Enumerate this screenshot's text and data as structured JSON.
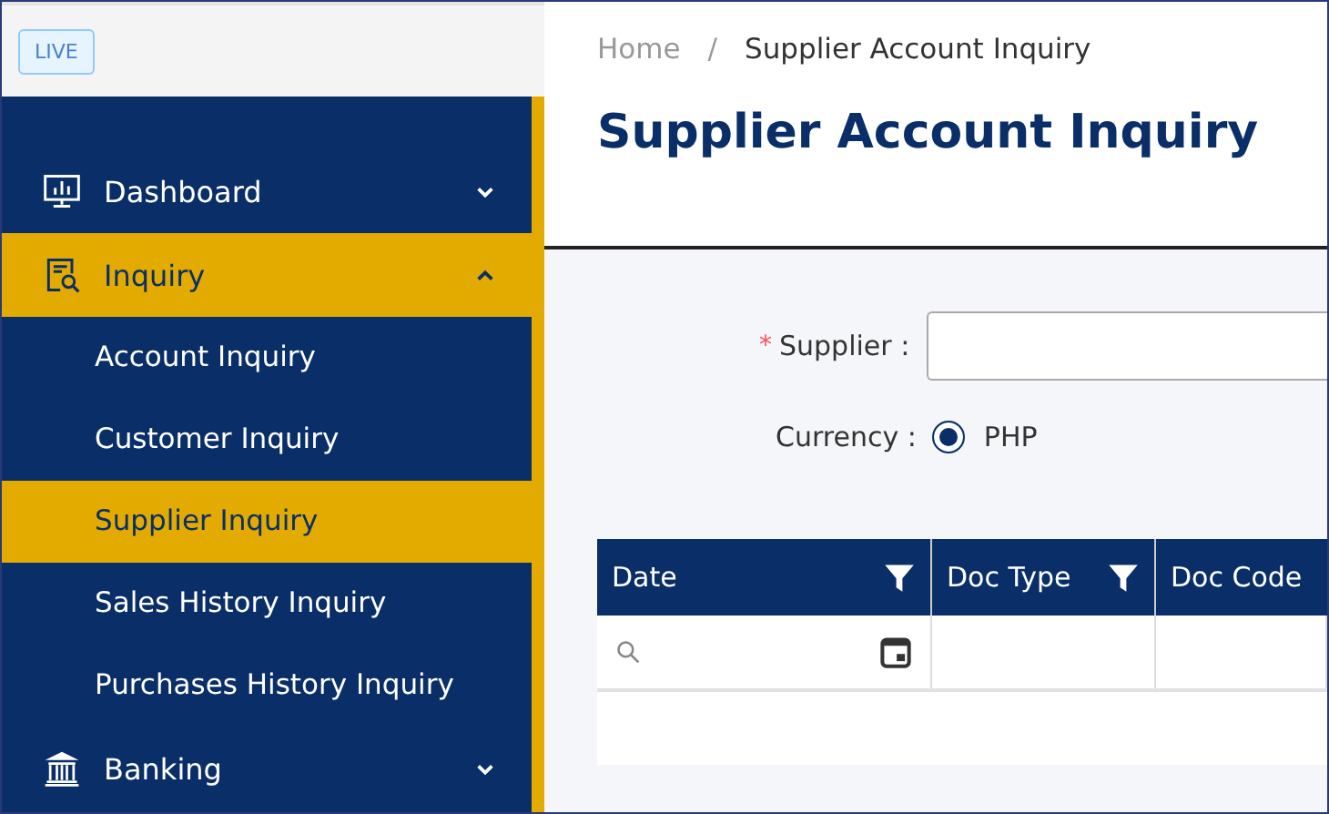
{
  "badge": "LIVE",
  "nav": [
    {
      "label": "Dashboard",
      "expanded": false,
      "selected": false
    },
    {
      "label": "Inquiry",
      "expanded": true,
      "selected": true,
      "children": [
        {
          "label": "Account Inquiry",
          "selected": false
        },
        {
          "label": "Customer Inquiry",
          "selected": false
        },
        {
          "label": "Supplier Inquiry",
          "selected": true
        },
        {
          "label": "Sales History Inquiry",
          "selected": false
        },
        {
          "label": "Purchases History Inquiry",
          "selected": false
        }
      ]
    },
    {
      "label": "Banking",
      "expanded": false,
      "selected": false
    }
  ],
  "breadcrumb": [
    "Home",
    "/",
    "Supplier Account Inquiry"
  ],
  "title": "Supplier Account Inquiry",
  "form": {
    "supplier": {
      "required_mark": "*",
      "label": "Supplier :"
    },
    "currency": {
      "label": "Currency :",
      "options": [
        {
          "label": "PHP",
          "selected": true
        }
      ]
    }
  },
  "table": {
    "columns": [
      {
        "label": "Date",
        "filter": true
      },
      {
        "label": "Doc Type",
        "filter": true
      },
      {
        "label": "Doc Code",
        "filter": false
      }
    ],
    "filter_row": [
      {
        "kind": "date"
      },
      {
        "kind": "empty"
      },
      {
        "kind": "empty"
      }
    ]
  }
}
